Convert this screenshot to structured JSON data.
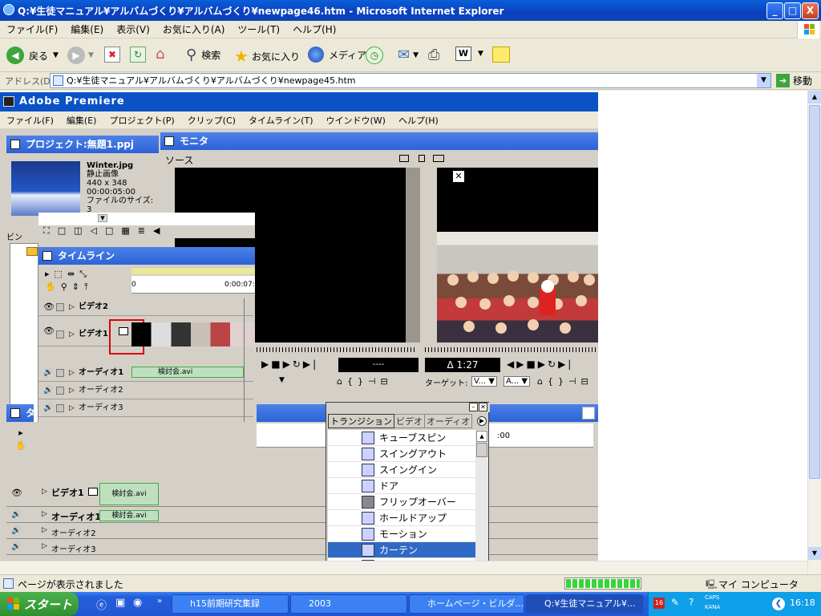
{
  "window": {
    "title": "Q:¥生徒マニュアル¥アルバムづくり¥アルバムづくり¥newpage46.htm - Microsoft Internet Explorer",
    "minimize": "_",
    "maximize": "□",
    "close": "X"
  },
  "menu": [
    "ファイル(F)",
    "編集(E)",
    "表示(V)",
    "お気に入り(A)",
    "ツール(T)",
    "ヘルプ(H)"
  ],
  "toolbar": {
    "back_label": "戻る",
    "search_label": "検索",
    "favorites_label": "お気に入り",
    "media_label": "メディア"
  },
  "address": {
    "label": "アドレス(D)",
    "value": "Q:¥生徒マニュアル¥アルバムづくり¥アルバムづくり¥newpage45.htm",
    "go_label": "移動"
  },
  "premiere": {
    "title": "Adobe Premiere",
    "menu": [
      "ファイル(F)",
      "編集(E)",
      "プロジェクト(P)",
      "クリップ(C)",
      "タイムライン(T)",
      "ウインドウ(W)",
      "ヘルプ(H)"
    ],
    "project": {
      "title": "プロジェクト:無題1.ppj",
      "file_name": "Winter.jpg",
      "file_type": "静止画像",
      "dimensions": "440 x 348",
      "duration": "00:00:05:00",
      "size_label": "ファイルのサイズ: 3",
      "bin_label": "ビン"
    },
    "monitor": {
      "title": "モニタ",
      "source_label": "ソース",
      "timecode_left": "----",
      "timecode_right": "Δ 1:27",
      "target_label": "ターゲット:",
      "target_v": "V...",
      "target_a": "A..."
    },
    "timeline": {
      "title": "タイムライン",
      "ruler_start": "0",
      "ruler_mid": "0:00:07:0",
      "tracks": [
        "ビデオ2",
        "ビデオ1",
        "オーディオ1",
        "オーディオ2",
        "オーディオ3"
      ],
      "audio_clip": "検討会.avi"
    },
    "timeline2": {
      "title": "タ",
      "tracks": [
        "ビデオ1",
        "オーディオ1",
        "オーディオ2",
        "オーディオ3"
      ],
      "video_clip": "検討会.avi",
      "audio_clip": "検討会.avi",
      "ruler_label": ":00"
    },
    "transitions": {
      "tabs": [
        "トランジション",
        "ビデオ",
        "オーディオ"
      ],
      "items": [
        "キューブスピン",
        "スイングアウト",
        "スイングイン",
        "ドア",
        "フリップオーバー",
        "ホールドアップ",
        "モーション",
        "カーテン",
        "回転"
      ],
      "selected_index": 7
    }
  },
  "status": {
    "text": "ページが表示されました",
    "zone": "マイ コンピュータ"
  },
  "taskbar": {
    "start_label": "スタート",
    "tasks": [
      "h15前期研究集録",
      "2003",
      "ホームページ・ビルダ...",
      "Q:¥生徒マニュアル¥..."
    ],
    "clock": "16:18",
    "tray_caps": "CAPS",
    "tray_kana": "KANA"
  }
}
